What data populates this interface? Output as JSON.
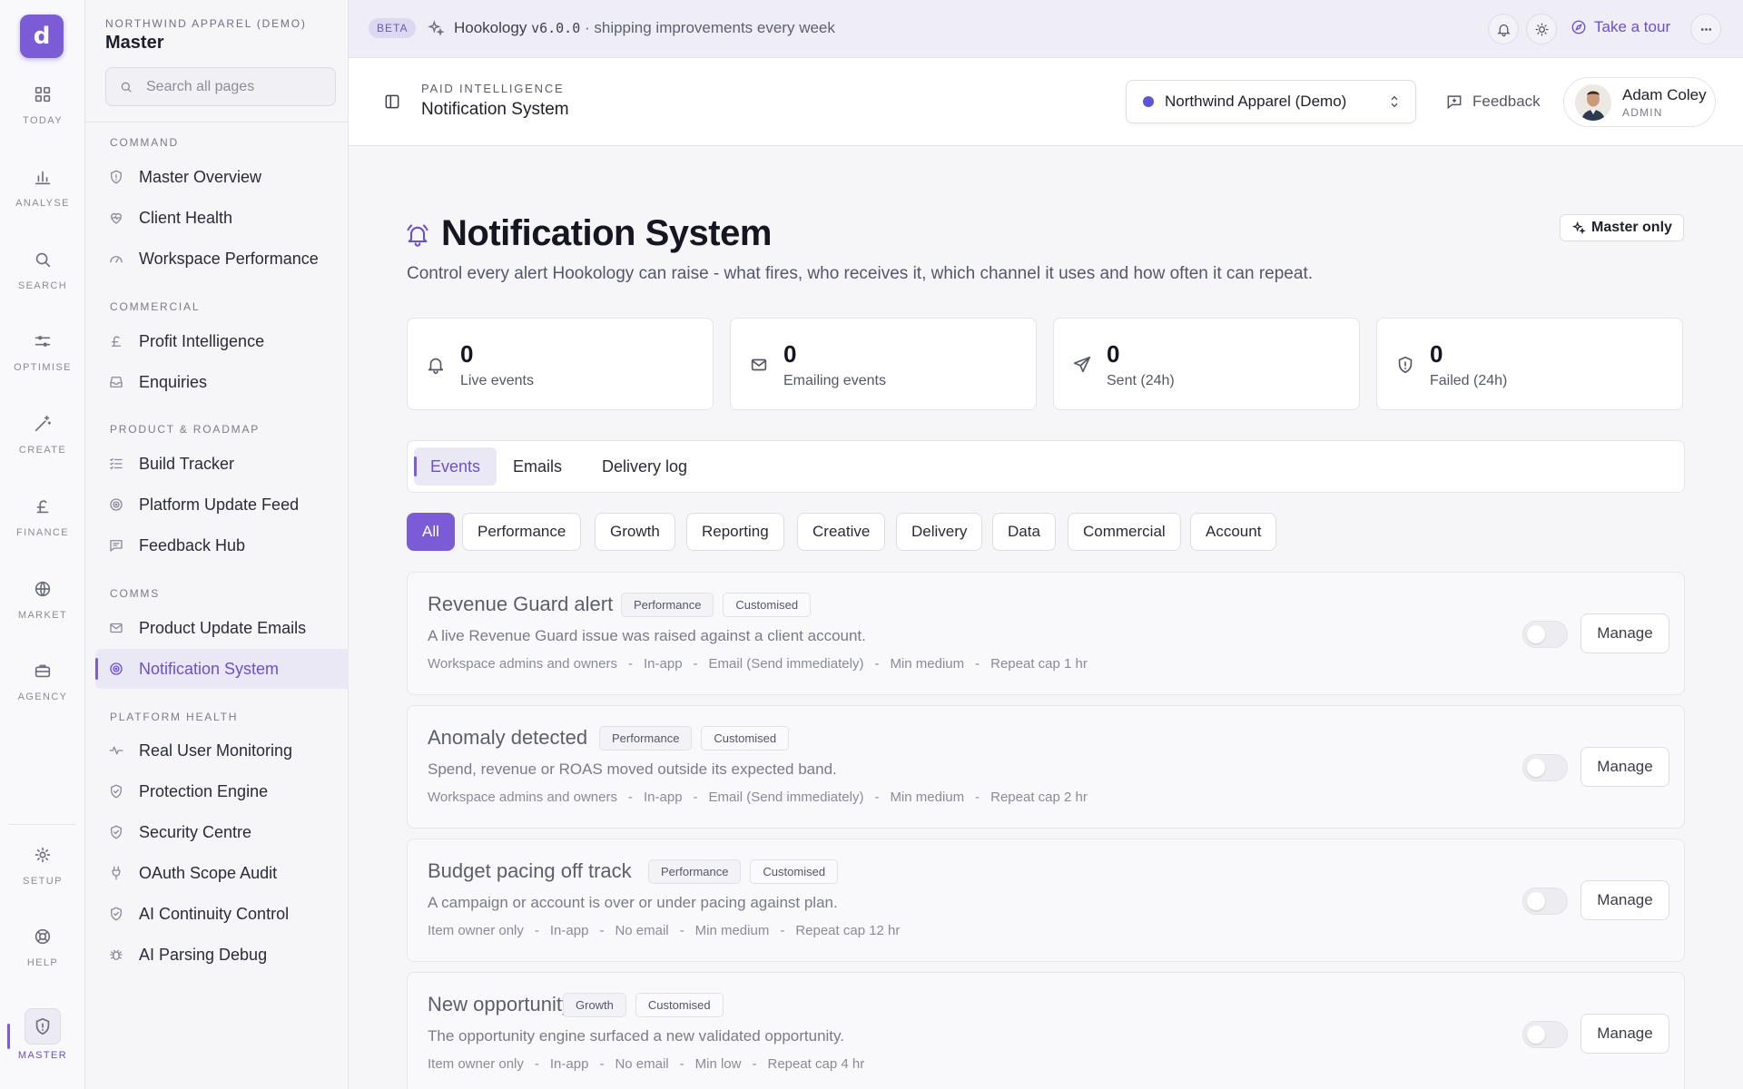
{
  "rail": {
    "logo_glyph": "d",
    "items": [
      {
        "label": "TODAY",
        "icon": "grid-icon"
      },
      {
        "label": "ANALYSE",
        "icon": "bar-chart-icon"
      },
      {
        "label": "SEARCH",
        "icon": "search-icon"
      },
      {
        "label": "OPTIMISE",
        "icon": "sliders-icon"
      },
      {
        "label": "CREATE",
        "icon": "magic-wand-icon"
      },
      {
        "label": "FINANCE",
        "icon": "pound-icon"
      },
      {
        "label": "MARKET",
        "icon": "globe-icon"
      },
      {
        "label": "AGENCY",
        "icon": "briefcase-icon"
      }
    ],
    "bottom": [
      {
        "label": "SETUP",
        "icon": "gear-icon"
      },
      {
        "label": "HELP",
        "icon": "lifebuoy-icon"
      },
      {
        "label": "MASTER",
        "icon": "shield-icon"
      }
    ]
  },
  "sidenav": {
    "org_label": "NORTHWIND APPAREL (DEMO)",
    "title": "Master",
    "search_placeholder": "Search all pages",
    "sections": [
      {
        "label": "COMMAND",
        "items": [
          "Master Overview",
          "Client Health",
          "Workspace Performance"
        ]
      },
      {
        "label": "COMMERCIAL",
        "items": [
          "Profit Intelligence",
          "Enquiries"
        ]
      },
      {
        "label": "PRODUCT & ROADMAP",
        "items": [
          "Build Tracker",
          "Platform Update Feed",
          "Feedback Hub"
        ]
      },
      {
        "label": "COMMS",
        "items": [
          "Product Update Emails",
          "Notification System"
        ]
      },
      {
        "label": "PLATFORM HEALTH",
        "items": [
          "Real User Monitoring",
          "Protection Engine",
          "Security Centre",
          "OAuth Scope Audit",
          "AI Continuity Control",
          "AI Parsing Debug"
        ]
      }
    ],
    "active_item": "Notification System"
  },
  "banner": {
    "badge": "BETA",
    "product": "Hookology",
    "version": "v6.0.0",
    "tagline": "· shipping improvements every week",
    "tour_label": "Take a tour"
  },
  "header": {
    "eyebrow": "PAID INTELLIGENCE",
    "title": "Notification System",
    "org_select": "Northwind Apparel (Demo)",
    "feedback_label": "Feedback",
    "user_name": "Adam Coley",
    "user_role": "ADMIN"
  },
  "page": {
    "title": "Notification System",
    "subtitle": "Control every alert Hookology can raise - what fires, who receives it, which channel it uses and how often it can repeat.",
    "badge": "Master only",
    "stats": [
      {
        "value": "0",
        "label": "Live events",
        "icon": "bell-icon"
      },
      {
        "value": "0",
        "label": "Emailing events",
        "icon": "mail-icon"
      },
      {
        "value": "0",
        "label": "Sent (24h)",
        "icon": "send-icon"
      },
      {
        "value": "0",
        "label": "Failed (24h)",
        "icon": "shield-alert-icon"
      }
    ],
    "tabs": [
      "Events",
      "Emails",
      "Delivery log"
    ],
    "active_tab": "Events",
    "filters": [
      "All",
      "Performance",
      "Growth",
      "Reporting",
      "Creative",
      "Delivery",
      "Data",
      "Commercial",
      "Account"
    ],
    "active_filter": "All",
    "events": [
      {
        "title": "Revenue Guard alert",
        "category": "Performance",
        "status": "Customised",
        "description": "A live Revenue Guard issue was raised against a client account.",
        "meta": [
          "Workspace admins and owners",
          "In-app",
          "Email (Send immediately)",
          "Min medium",
          "Repeat cap 1 hr"
        ],
        "enabled": false,
        "action": "Manage"
      },
      {
        "title": "Anomaly detected",
        "category": "Performance",
        "status": "Customised",
        "description": "Spend, revenue or ROAS moved outside its expected band.",
        "meta": [
          "Workspace admins and owners",
          "In-app",
          "Email (Send immediately)",
          "Min medium",
          "Repeat cap 2 hr"
        ],
        "enabled": false,
        "action": "Manage"
      },
      {
        "title": "Budget pacing off track",
        "category": "Performance",
        "status": "Customised",
        "description": "A campaign or account is over or under pacing against plan.",
        "meta": [
          "Item owner only",
          "In-app",
          "No email",
          "Min medium",
          "Repeat cap 12 hr"
        ],
        "enabled": false,
        "action": "Manage"
      },
      {
        "title": "New opportunity",
        "category": "Growth",
        "status": "Customised",
        "description": "The opportunity engine surfaced a new validated opportunity.",
        "meta": [
          "Item owner only",
          "In-app",
          "No email",
          "Min low",
          "Repeat cap 4 hr"
        ],
        "enabled": false,
        "action": "Manage"
      }
    ]
  },
  "colors": {
    "accent": "#7b5cd6",
    "accent_text": "#6b4fcf",
    "background": "#f6f6f9"
  }
}
